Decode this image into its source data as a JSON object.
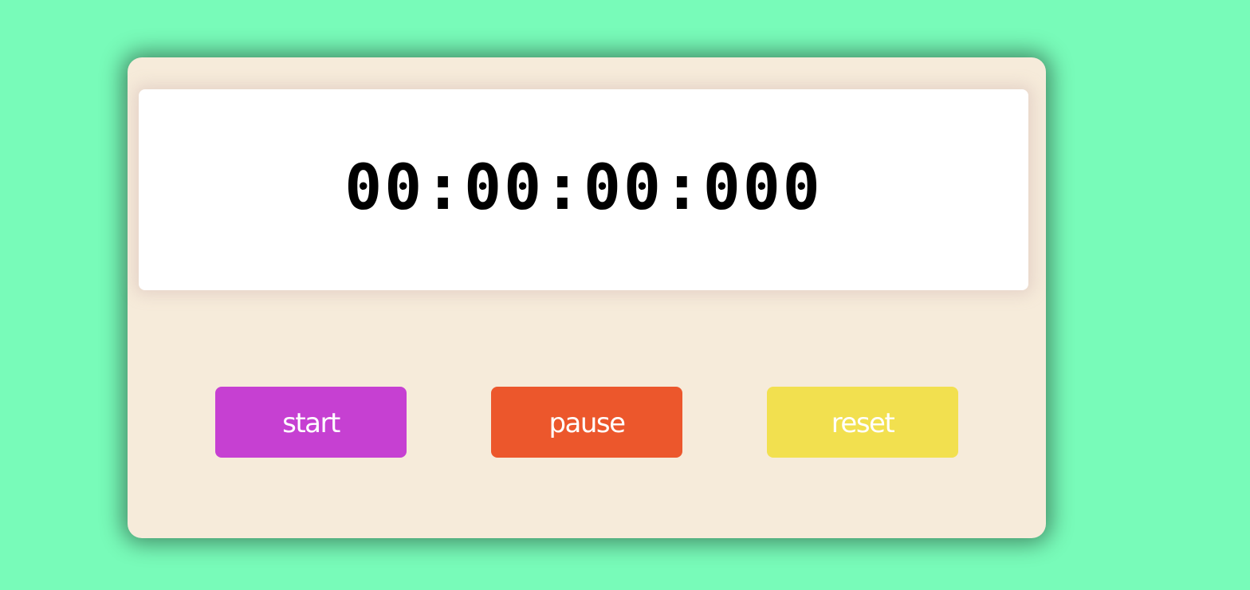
{
  "stopwatch": {
    "display": "00:00:00:000",
    "buttons": {
      "start_label": "start",
      "pause_label": "pause",
      "reset_label": "reset"
    }
  },
  "colors": {
    "page_background": "#78fbb9",
    "card_background": "#f6ebda",
    "display_background": "#ffffff",
    "start_button": "#c640d2",
    "pause_button": "#ec572c",
    "reset_button": "#f2e04f",
    "button_text": "#ffffff"
  }
}
